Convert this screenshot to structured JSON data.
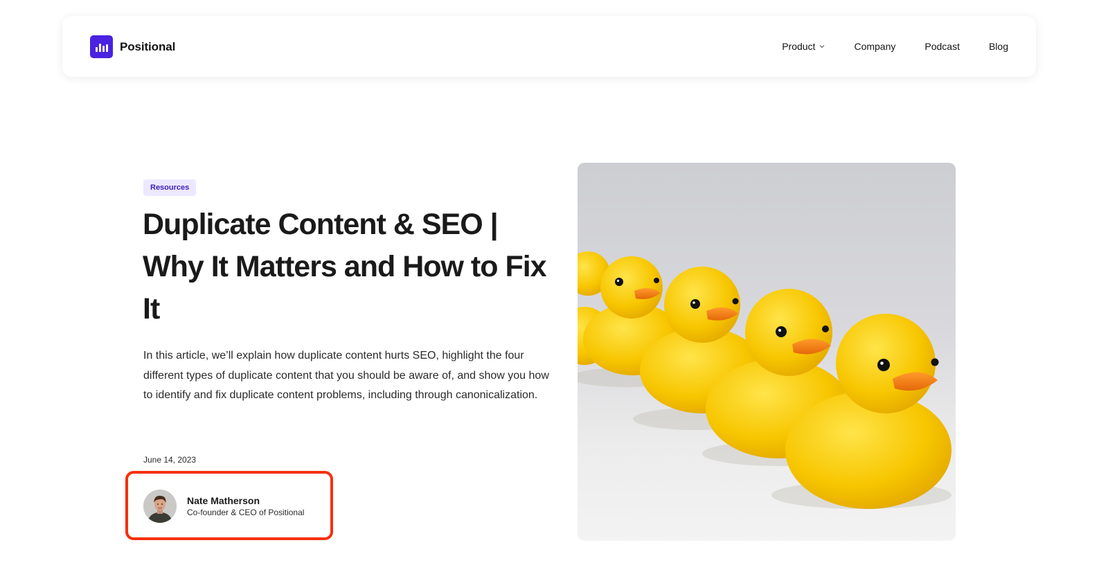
{
  "header": {
    "brand_name": "Positional",
    "nav": [
      {
        "label": "Product",
        "has_dropdown": true
      },
      {
        "label": "Company"
      },
      {
        "label": "Podcast"
      },
      {
        "label": "Blog"
      }
    ]
  },
  "hero": {
    "tag": "Resources",
    "title": "Duplicate Content & SEO | Why It Matters and How to Fix It",
    "lead": "In this article, we’ll explain how duplicate content hurts SEO, highlight the four different types of duplicate content that you should be aware of, and show you how to identify and fix duplicate content problems, including through canonicalization.",
    "date": "June 14, 2023",
    "author": {
      "name": "Nate Matherson",
      "role": "Co-founder & CEO of Positional"
    }
  },
  "colors": {
    "brand": "#4a22e0",
    "tag_background": "#ece8ff",
    "tag_text": "#3b1fb8",
    "highlight": "#f5300d",
    "duck_yellow": "#f7c600",
    "duck_beak": "#f57f0f"
  },
  "icons": {
    "logo": "bar-chart-icon",
    "dropdown": "chevron-down-icon"
  },
  "image": {
    "subject": "row of yellow rubber ducks"
  }
}
